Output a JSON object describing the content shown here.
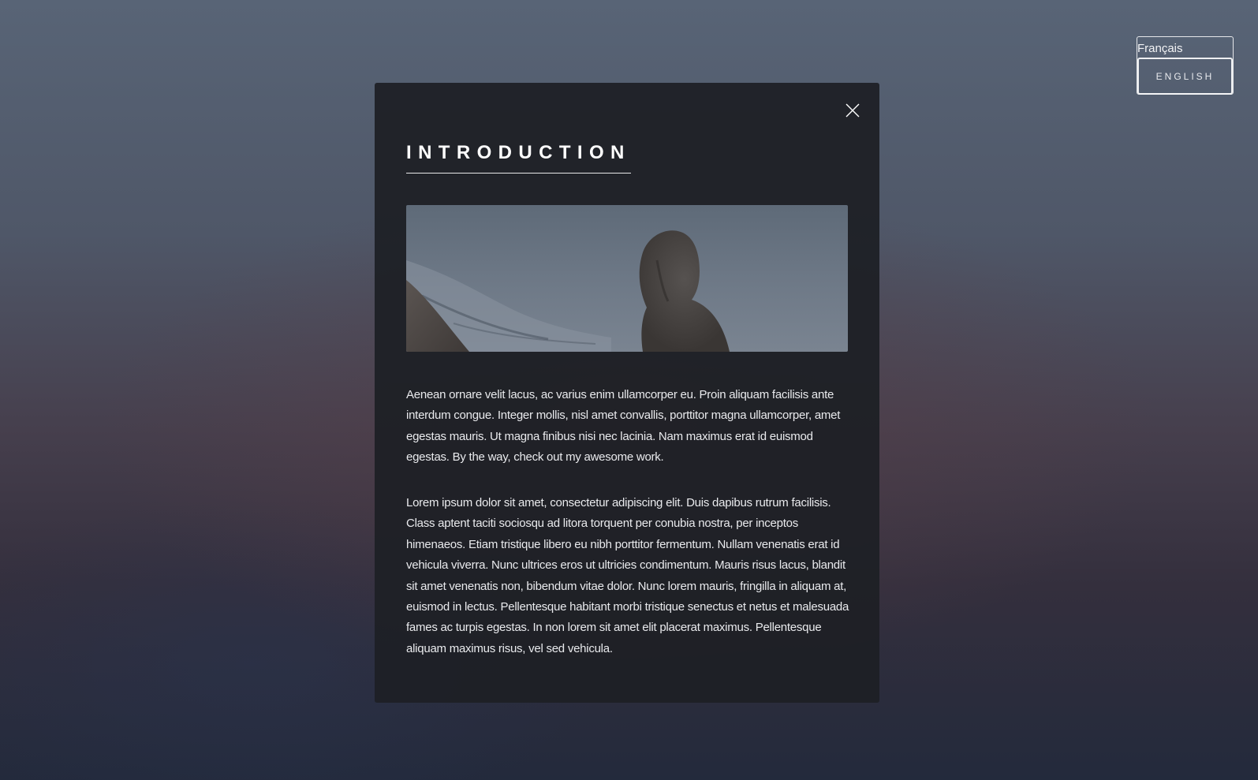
{
  "language_switcher": {
    "current_label": "Français",
    "button_label": "ENGLISH"
  },
  "modal": {
    "close_icon": "close-icon",
    "title": "INTRODUCTION",
    "image_icon": "hooded-figure-by-sea-photo",
    "paragraphs": [
      "Aenean ornare velit lacus, ac varius enim ullamcorper eu. Proin aliquam facilisis ante interdum congue. Integer mollis, nisl amet convallis, porttitor magna ullamcorper, amet egestas mauris. Ut magna finibus nisi nec lacinia. Nam maximus erat id euismod egestas. By the way, check out my awesome work.",
      "Lorem ipsum dolor sit amet, consectetur adipiscing elit. Duis dapibus rutrum facilisis. Class aptent taciti sociosqu ad litora torquent per conubia nostra, per inceptos himenaeos. Etiam tristique libero eu nibh porttitor fermentum. Nullam venenatis erat id vehicula viverra. Nunc ultrices eros ut ultricies condimentum. Mauris risus lacus, blandit sit amet venenatis non, bibendum vitae dolor. Nunc lorem mauris, fringilla in aliquam at, euismod in lectus. Pellentesque habitant morbi tristique senectus et netus et malesuada fames ac turpis egestas. In non lorem sit amet elit placerat maximus. Pellentesque aliquam maximus risus, vel sed vehicula."
    ]
  },
  "colors": {
    "modal_bg": "#1e2025",
    "text": "#e9eaed",
    "title": "#ffffff",
    "background_top": "#586476",
    "background_bottom": "#232a3c"
  }
}
